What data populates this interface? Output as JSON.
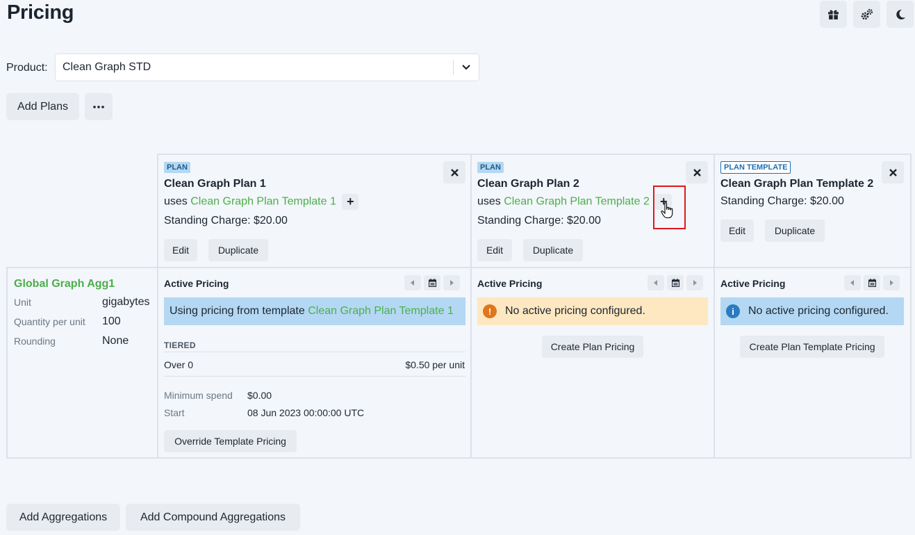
{
  "page": {
    "title": "Pricing"
  },
  "top_icons": [
    "gift-icon",
    "settings-icon",
    "moon-icon"
  ],
  "product": {
    "label": "Product:",
    "value": "Clean Graph STD"
  },
  "toolbar": {
    "add_plans": "Add Plans",
    "more": "•••"
  },
  "plans": [
    {
      "badge": "PLAN",
      "title": "Clean Graph Plan 1",
      "uses_prefix": "uses",
      "template_link": "Clean Graph Plan Template 1",
      "standing_charge": "Standing Charge: $20.00",
      "edit": "Edit",
      "duplicate": "Duplicate",
      "close": "×"
    },
    {
      "badge": "PLAN",
      "title": "Clean Graph Plan 2",
      "uses_prefix": "uses",
      "template_link": "Clean Graph Plan Template 2",
      "standing_charge": "Standing Charge: $20.00",
      "edit": "Edit",
      "duplicate": "Duplicate",
      "close": "×"
    },
    {
      "badge": "PLAN TEMPLATE",
      "title": "Clean Graph Plan Template 2",
      "standing_charge": "Standing Charge: $20.00",
      "edit": "Edit",
      "duplicate": "Duplicate",
      "close": "×"
    }
  ],
  "aggregation": {
    "name": "Global Graph Agg1",
    "rows": [
      {
        "label": "Unit",
        "value": "gigabytes"
      },
      {
        "label": "Quantity per unit",
        "value": "100"
      },
      {
        "label": "Rounding",
        "value": "None"
      }
    ]
  },
  "pricing": [
    {
      "title": "Active Pricing",
      "alert_prefix": "Using pricing from template",
      "alert_link": "Clean Graph Plan Template 1",
      "tiered_label": "TIERED",
      "tier_range": "Over 0",
      "tier_price": "$0.50 per unit",
      "min_spend_label": "Minimum spend",
      "min_spend_value": "$0.00",
      "start_label": "Start",
      "start_value": "08 Jun 2023 00:00:00 UTC",
      "action": "Override Template Pricing"
    },
    {
      "title": "Active Pricing",
      "alert": "No active pricing configured.",
      "action": "Create Plan Pricing"
    },
    {
      "title": "Active Pricing",
      "alert": "No active pricing configured.",
      "action": "Create Plan Template Pricing"
    }
  ],
  "bottom": {
    "add_aggregations": "Add Aggregations",
    "add_compound": "Add Compound Aggregations"
  },
  "colors": {
    "link": "#4cae4c",
    "info": "#b4d8f3",
    "warn": "#fde8c1",
    "warn_icon": "#e0761c",
    "info_icon": "#2b7bc0",
    "highlight": "#e0161c"
  }
}
